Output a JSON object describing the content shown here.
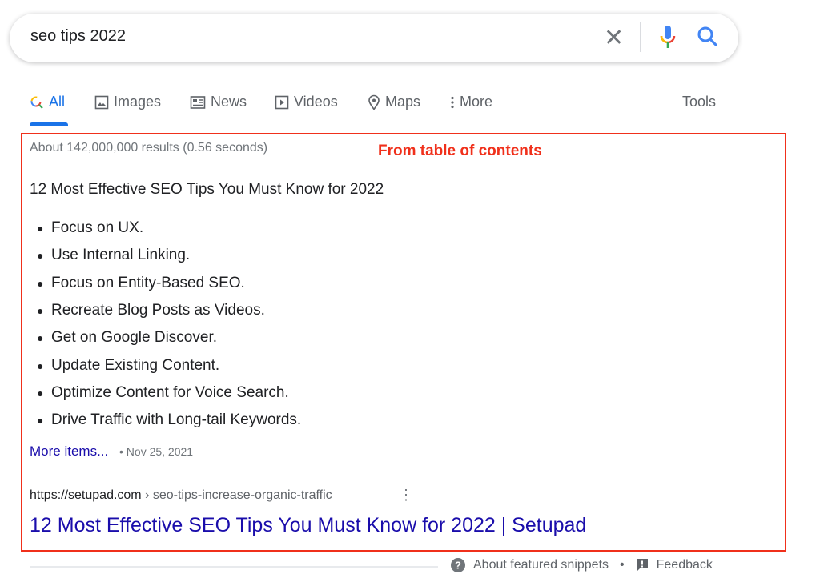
{
  "search": {
    "query": "seo tips 2022"
  },
  "tabs": [
    {
      "label": "All",
      "icon": "google-search-icon"
    },
    {
      "label": "Images",
      "icon": "image-icon"
    },
    {
      "label": "News",
      "icon": "news-icon"
    },
    {
      "label": "Videos",
      "icon": "play-icon"
    },
    {
      "label": "Maps",
      "icon": "map-pin-icon"
    },
    {
      "label": "More",
      "icon": "kebab-icon"
    }
  ],
  "tools_label": "Tools",
  "result_stats": "About 142,000,000 results (0.56 seconds)",
  "annotation": "From table of contents",
  "snippet": {
    "heading": "12 Most Effective SEO Tips You Must Know for 2022",
    "items": [
      "Focus on UX.",
      "Use Internal Linking.",
      "Focus on Entity-Based SEO.",
      "Recreate Blog Posts as Videos.",
      "Get on Google Discover.",
      "Update Existing Content.",
      "Optimize Content for Voice Search.",
      "Drive Traffic with Long-tail Keywords."
    ],
    "more_items": "More items...",
    "date": "Nov 25, 2021",
    "url_domain": "https://setupad.com",
    "url_path": " › seo-tips-increase-organic-traffic",
    "title": "12 Most Effective SEO Tips You Must Know for 2022 | Setupad"
  },
  "footer": {
    "about": "About featured snippets",
    "separator": "•",
    "feedback": "Feedback"
  },
  "colors": {
    "link": "#1a0dab",
    "accent": "#1a73e8",
    "annotation": "#f0301b"
  }
}
